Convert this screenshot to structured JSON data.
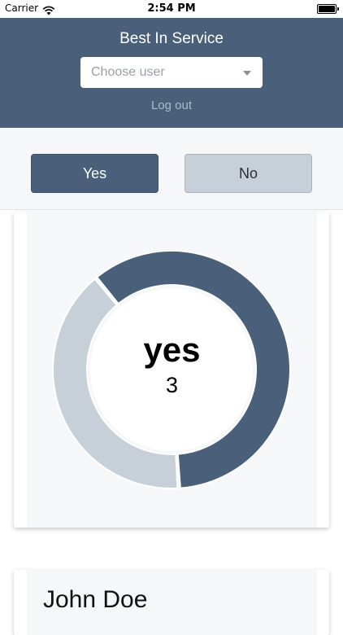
{
  "status_bar": {
    "carrier": "Carrier",
    "time": "2:54 PM"
  },
  "header": {
    "title": "Best In Service",
    "user_select": {
      "placeholder": "Choose user"
    },
    "logout": "Log out"
  },
  "answer_buttons": {
    "yes": "Yes",
    "no": "No"
  },
  "chart_data": {
    "type": "pie",
    "categories": [
      "yes",
      "no"
    ],
    "values": [
      3,
      2
    ],
    "colors": [
      "#495f7a",
      "#c7cfd8"
    ],
    "center_label": "yes",
    "center_value": "3"
  },
  "person": {
    "name": "John Doe"
  },
  "colors": {
    "header": "#495f7a",
    "accent": "#495f7a",
    "muted": "#c7cfd8"
  }
}
